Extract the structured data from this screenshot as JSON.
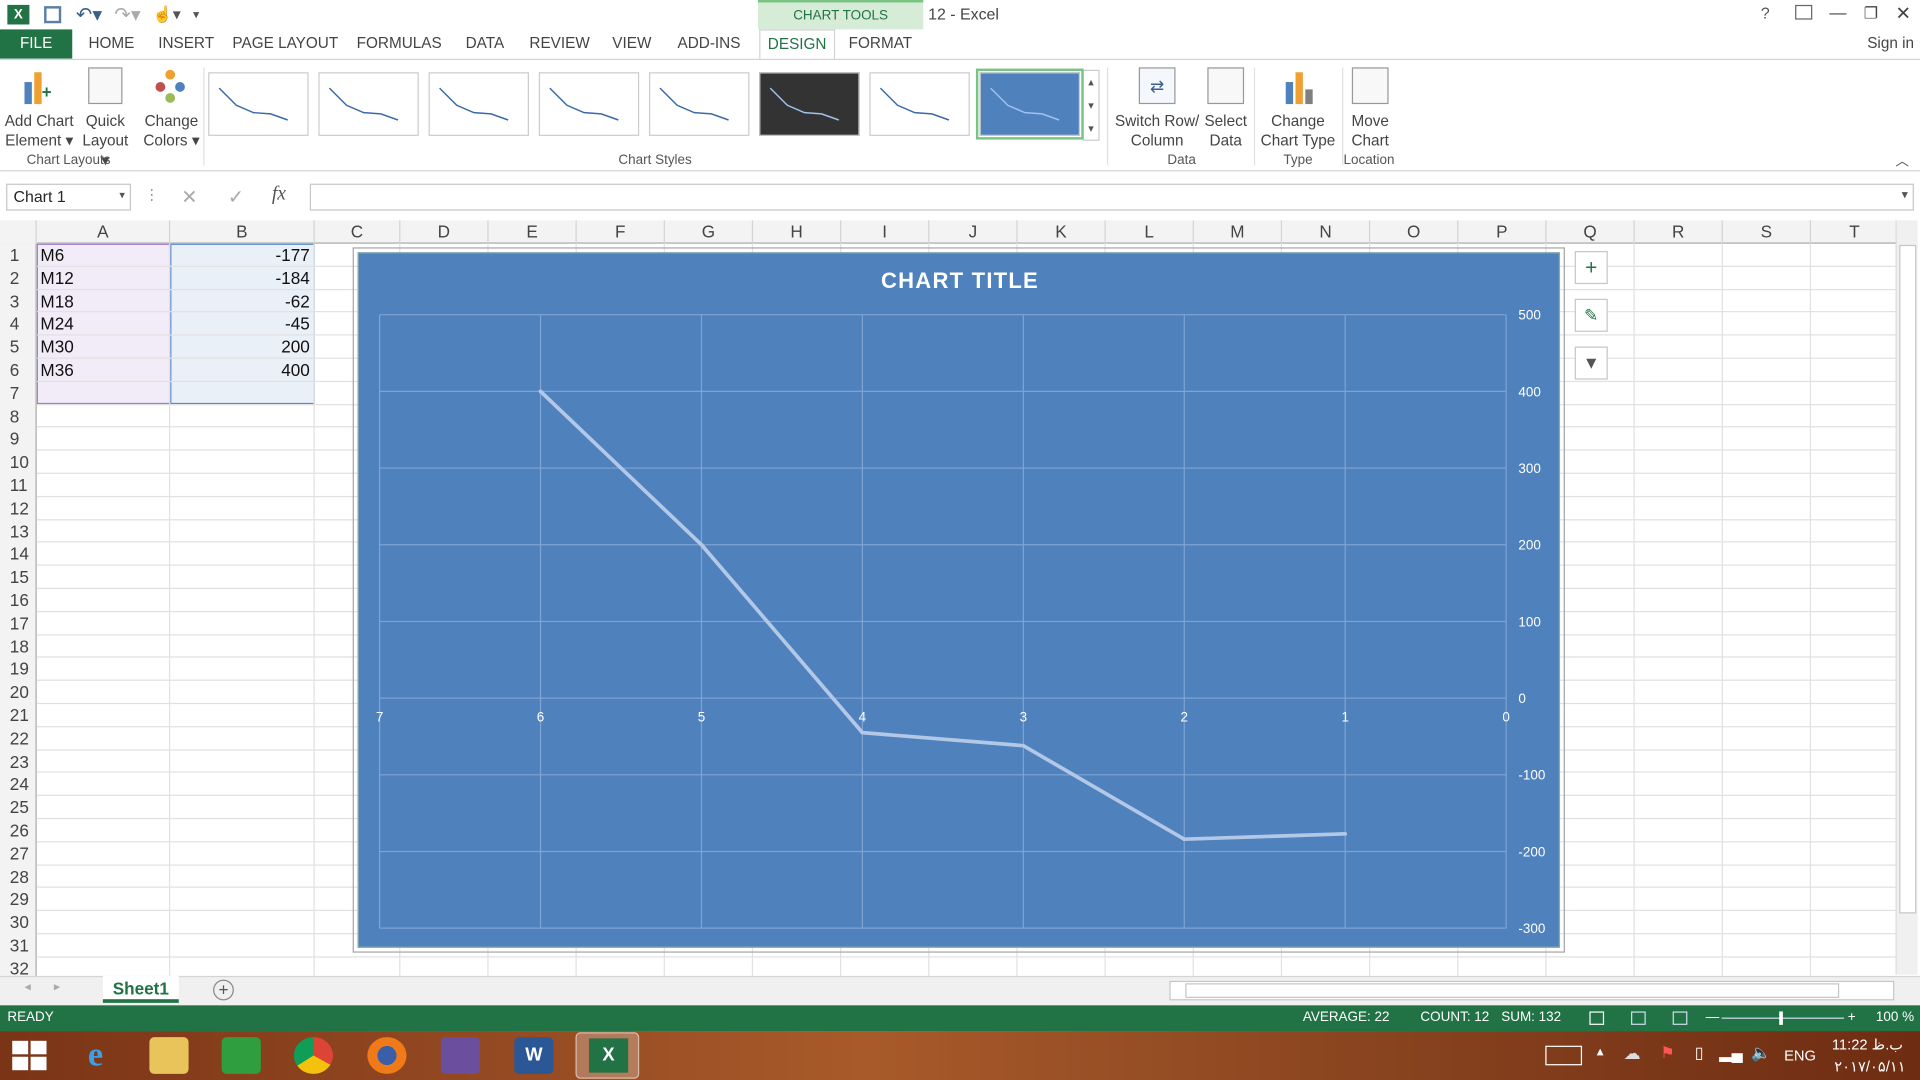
{
  "window": {
    "title": "12 - Excel",
    "sign_in": "Sign in",
    "context_tab_group": "CHART TOOLS"
  },
  "tabs": [
    "FILE",
    "HOME",
    "INSERT",
    "PAGE LAYOUT",
    "FORMULAS",
    "DATA",
    "REVIEW",
    "VIEW",
    "ADD-INS",
    "DESIGN",
    "FORMAT"
  ],
  "ribbon": {
    "add_chart_element": [
      "Add Chart",
      "Element ▾"
    ],
    "quick_layout": [
      "Quick",
      "Layout ▾"
    ],
    "change_colors": [
      "Change",
      "Colors ▾"
    ],
    "switch_row_column": [
      "Switch Row/",
      "Column"
    ],
    "select_data": [
      "Select",
      "Data"
    ],
    "change_chart_type": [
      "Change",
      "Chart Type"
    ],
    "move_chart": [
      "Move",
      "Chart"
    ],
    "groups": {
      "chart_layouts": "Chart Layouts",
      "chart_styles": "Chart Styles",
      "data": "Data",
      "type": "Type",
      "location": "Location"
    },
    "style_count": 8,
    "selected_style": 8
  },
  "formula_bar": {
    "name_box": "Chart 1",
    "fx": "fx",
    "formula": ""
  },
  "columns": [
    "A",
    "B",
    "C",
    "D",
    "E",
    "F",
    "G",
    "H",
    "I",
    "J",
    "K",
    "L",
    "M",
    "N",
    "O",
    "P",
    "Q",
    "R",
    "S",
    "T"
  ],
  "rows": [
    "1",
    "2",
    "3",
    "4",
    "5",
    "6",
    "7",
    "8",
    "9",
    "10",
    "11",
    "12",
    "13",
    "14",
    "15",
    "16",
    "17",
    "18",
    "19",
    "20",
    "21",
    "22",
    "23",
    "24",
    "25",
    "26",
    "27",
    "28",
    "29",
    "30",
    "31",
    "32"
  ],
  "cells": [
    {
      "a": "M6",
      "b": "-177"
    },
    {
      "a": "M12",
      "b": "-184"
    },
    {
      "a": "M18",
      "b": "-62"
    },
    {
      "a": "M24",
      "b": "-45"
    },
    {
      "a": "M30",
      "b": "200"
    },
    {
      "a": "M36",
      "b": "400"
    }
  ],
  "chart_data": {
    "type": "line",
    "title": "CHART TITLE",
    "x": [
      1,
      2,
      3,
      4,
      5,
      6
    ],
    "series": [
      {
        "values": [
          -177,
          -184,
          -62,
          -45,
          200,
          400
        ]
      }
    ],
    "x_ticks": [
      "7",
      "6",
      "5",
      "4",
      "3",
      "2",
      "1",
      "0"
    ],
    "xlim": [
      7,
      0
    ],
    "x_reversed": true,
    "y_ticks": [
      "500",
      "400",
      "300",
      "200",
      "100",
      "0",
      "-100",
      "-200",
      "-300"
    ],
    "ylim": [
      -300,
      500
    ],
    "y_axis_position": "right",
    "grid": true,
    "background": "#4f81bd",
    "line_color": "#b3c8e6"
  },
  "sheet_tabs": [
    "Sheet1"
  ],
  "status": {
    "mode": "READY",
    "average": "AVERAGE: 22",
    "count": "COUNT: 12",
    "sum": "SUM: 132",
    "zoom": "100 %"
  },
  "taskbar": {
    "lang": "ENG",
    "time": "11:22 ب.ظ",
    "date": "۲۰۱۷/۰۵/۱۱"
  },
  "colors": {
    "excel_green": "#217346",
    "chart_bg": "#4f81bd"
  }
}
